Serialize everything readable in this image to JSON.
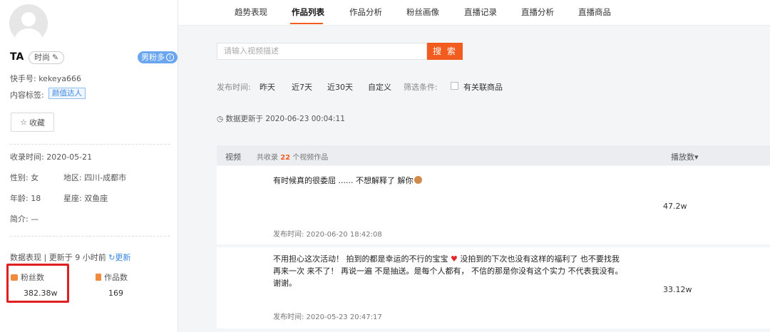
{
  "profile": {
    "name": "TA",
    "style_tag": "时尚",
    "gender_badge": "男粉多",
    "account_label": "快手号: kekeya666",
    "content_tag_label": "内容标签:",
    "content_tag": "颜值达人",
    "favorite_label": "收藏",
    "collected_time": "收录时间: 2020-05-21",
    "gender": "性别: 女",
    "region": "地区: 四川-成都市",
    "age": "年龄: 18",
    "zodiac": "星座: 双鱼座",
    "intro": "简介: —",
    "data_perf": "数据表现",
    "updated_ago": "更新于 9 小时前",
    "refresh_label": "更新",
    "fans_label": "粉丝数",
    "fans_value": "382.38w",
    "works_label": "作品数",
    "works_value": "169"
  },
  "tabs": [
    "趋势表现",
    "作品列表",
    "作品分析",
    "粉丝画像",
    "直播记录",
    "直播分析",
    "直播商品"
  ],
  "active_tab": "作品列表",
  "search": {
    "placeholder": "请输入视频描述",
    "button": "搜 索"
  },
  "filters": {
    "time_label": "发布时间:",
    "options": [
      "昨天",
      "近7天",
      "近30天",
      "自定义"
    ],
    "cond_label": "筛选条件:",
    "goods_label": "有关联商品"
  },
  "update_time": "数据更新于  2020-06-23 00:04:11",
  "table": {
    "col_video": "视频",
    "count_prefix": "共收录",
    "count": "22",
    "count_suffix": "个视频作品",
    "col_plays": "播放数▾"
  },
  "videos": [
    {
      "desc": "有时候真的很委屈 ...... 不想解释了 解你",
      "date": "发布时间: 2020-06-20 18:42:08",
      "plays": "47.2w"
    },
    {
      "desc1": "不用担心这次活动！ 拍到的都是幸运的不行的宝宝",
      "desc1b": "没拍到的下次也没有这样的福利了 也不要找我",
      "desc2": "再来一次 来不了！ 再说一遍 不是抽送。是每个人都有， 不信的那是你没有这个实力 不代表我没有。",
      "desc3": "谢谢。",
      "date": "发布时间: 2020-05-23 20:47:17",
      "plays": "33.12w"
    }
  ],
  "colors": {
    "accent": "#f25c1e",
    "highlight": "#e02020",
    "link": "#3b87e0"
  }
}
